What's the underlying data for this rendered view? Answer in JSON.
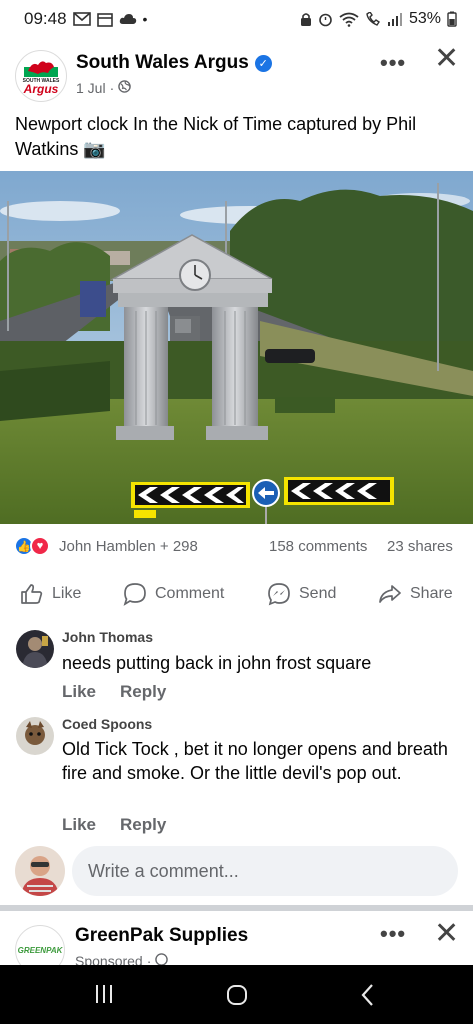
{
  "status_bar": {
    "time": "09:48",
    "battery": "53%"
  },
  "post": {
    "page_name": "South Wales Argus",
    "logo_top": "SOUTH WALES",
    "logo_word": "Argus",
    "date": "1 Jul",
    "text": "Newport clock In the Nick of Time captured by Phil Watkins 📷",
    "reactors": "John Hamblen + 298",
    "comments_count": "158 comments",
    "shares_count": "23 shares",
    "icons": {
      "verified": "verified-badge-icon",
      "privacy": "globe-icon",
      "more": "more-options-icon",
      "close": "close-icon"
    }
  },
  "actions": {
    "like": "Like",
    "comment": "Comment",
    "send": "Send",
    "share": "Share"
  },
  "comments": [
    {
      "author": "John Thomas",
      "text": "needs putting back in john frost square",
      "like": "Like",
      "reply": "Reply"
    },
    {
      "author": "Coed Spoons",
      "text": "Old Tick Tock , bet it no longer opens and breath fire and smoke. Or the little devil's pop out.",
      "like": "Like",
      "reply": "Reply"
    }
  ],
  "composer": {
    "placeholder": "Write a comment..."
  },
  "next_post": {
    "page_name": "GreenPak Supplies",
    "logo_text": "GREENPAK",
    "meta": "Sponsored"
  },
  "colors": {
    "facebook_blue": "#1b74e4",
    "love_red": "#f02849",
    "secondary_text": "#65676b",
    "chevron_yellow": "#f5e400"
  }
}
